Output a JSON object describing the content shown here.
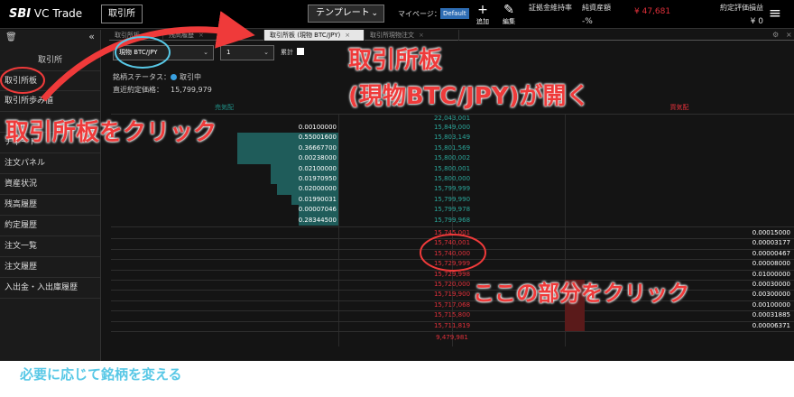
{
  "header": {
    "logo_main": "SBI",
    "logo_sub": " VC Trade",
    "trade_button": "取引所",
    "template_label": "テンプレート",
    "mypage_label": "マイページ：",
    "default_badge": "Default",
    "add_label": "追加",
    "edit_label": "編集",
    "stats": [
      {
        "label": "証拠金維持率",
        "value": "",
        "tone": "plain"
      },
      {
        "label": "純資産額",
        "value": "-%",
        "tone": "plain"
      },
      {
        "label": "",
        "value": "¥ 47,681",
        "tone": "red"
      },
      {
        "label": "約定評価損益",
        "value": "¥ 0",
        "tone": "plain"
      }
    ]
  },
  "sidebar": {
    "title": "取引所",
    "items": [
      {
        "label": "取引所板"
      },
      {
        "label": "取引所歩み値"
      },
      {
        "label": ""
      },
      {
        "label": "チャート"
      },
      {
        "label": "注文パネル"
      },
      {
        "label": "資産状況"
      },
      {
        "label": "残高履歴"
      },
      {
        "label": "約定履歴"
      },
      {
        "label": "注文一覧"
      },
      {
        "label": "注文履歴"
      },
      {
        "label": "入出金・入出庫履歴"
      }
    ]
  },
  "tabs": [
    {
      "label": "取引所板",
      "active": false
    },
    {
      "label": "残高履歴",
      "active": false
    },
    {
      "label": "取引所板 (現物 BTC/JPY)",
      "active": true
    },
    {
      "label": "取引所現物注文",
      "active": false
    }
  ],
  "toolbar": {
    "pair": "現物 BTC/JPY",
    "step": "1",
    "cumulative_label": "累計"
  },
  "info": {
    "status_label": "銘柄ステータス：",
    "status_value": "取引中",
    "last_price_label": "直近約定価格：",
    "last_price_value": "15,799,979"
  },
  "board": {
    "sell_header": "売気配",
    "buy_header": "買気配",
    "top_price": "22,043,001",
    "asks": [
      {
        "qty": "0.00100000",
        "price": "15,849,000"
      },
      {
        "qty": "0.55001600",
        "price": "15,803,149"
      },
      {
        "qty": "0.36667700",
        "price": "15,801,569"
      },
      {
        "qty": "0.00238000",
        "price": "15,800,002"
      },
      {
        "qty": "0.02100000",
        "price": "15,800,001"
      },
      {
        "qty": "0.01970950",
        "price": "15,800,000"
      },
      {
        "qty": "0.02000000",
        "price": "15,799,999"
      },
      {
        "qty": "0.01990031",
        "price": "15,799,990"
      },
      {
        "qty": "0.00007046",
        "price": "15,799,978"
      },
      {
        "qty": "0.28344500",
        "price": "15,799,968"
      }
    ],
    "bids": [
      {
        "price": "15,745,001",
        "qty": "0.00015000"
      },
      {
        "price": "15,740,001",
        "qty": "0.00003177"
      },
      {
        "price": "15,740,000",
        "qty": "0.00000467"
      },
      {
        "price": "15,729,999",
        "qty": "0.00008000"
      },
      {
        "price": "15,729,998",
        "qty": "0.01000000"
      },
      {
        "price": "15,720,000",
        "qty": "0.00030000"
      },
      {
        "price": "15,719,900",
        "qty": "0.00300000"
      },
      {
        "price": "15,717,068",
        "qty": "0.00100000"
      },
      {
        "price": "15,715,800",
        "qty": "0.00031885"
      },
      {
        "price": "15,711,819",
        "qty": "0.00006371"
      }
    ],
    "bottom_price": "9,479,981"
  },
  "annotations": {
    "click_board": "取引所板をクリック",
    "opens_line1": "取引所板",
    "opens_line2": "(現物BTC/JPY)が開く",
    "click_here": "ここの部分をクリック",
    "change_pair": "必要に応じて銘柄を変える"
  },
  "colors": {
    "ask": "#2aa69a",
    "bid": "#e0303a",
    "annotation_red": "#ef3a3a",
    "annotation_cyan": "#58c8e6"
  }
}
